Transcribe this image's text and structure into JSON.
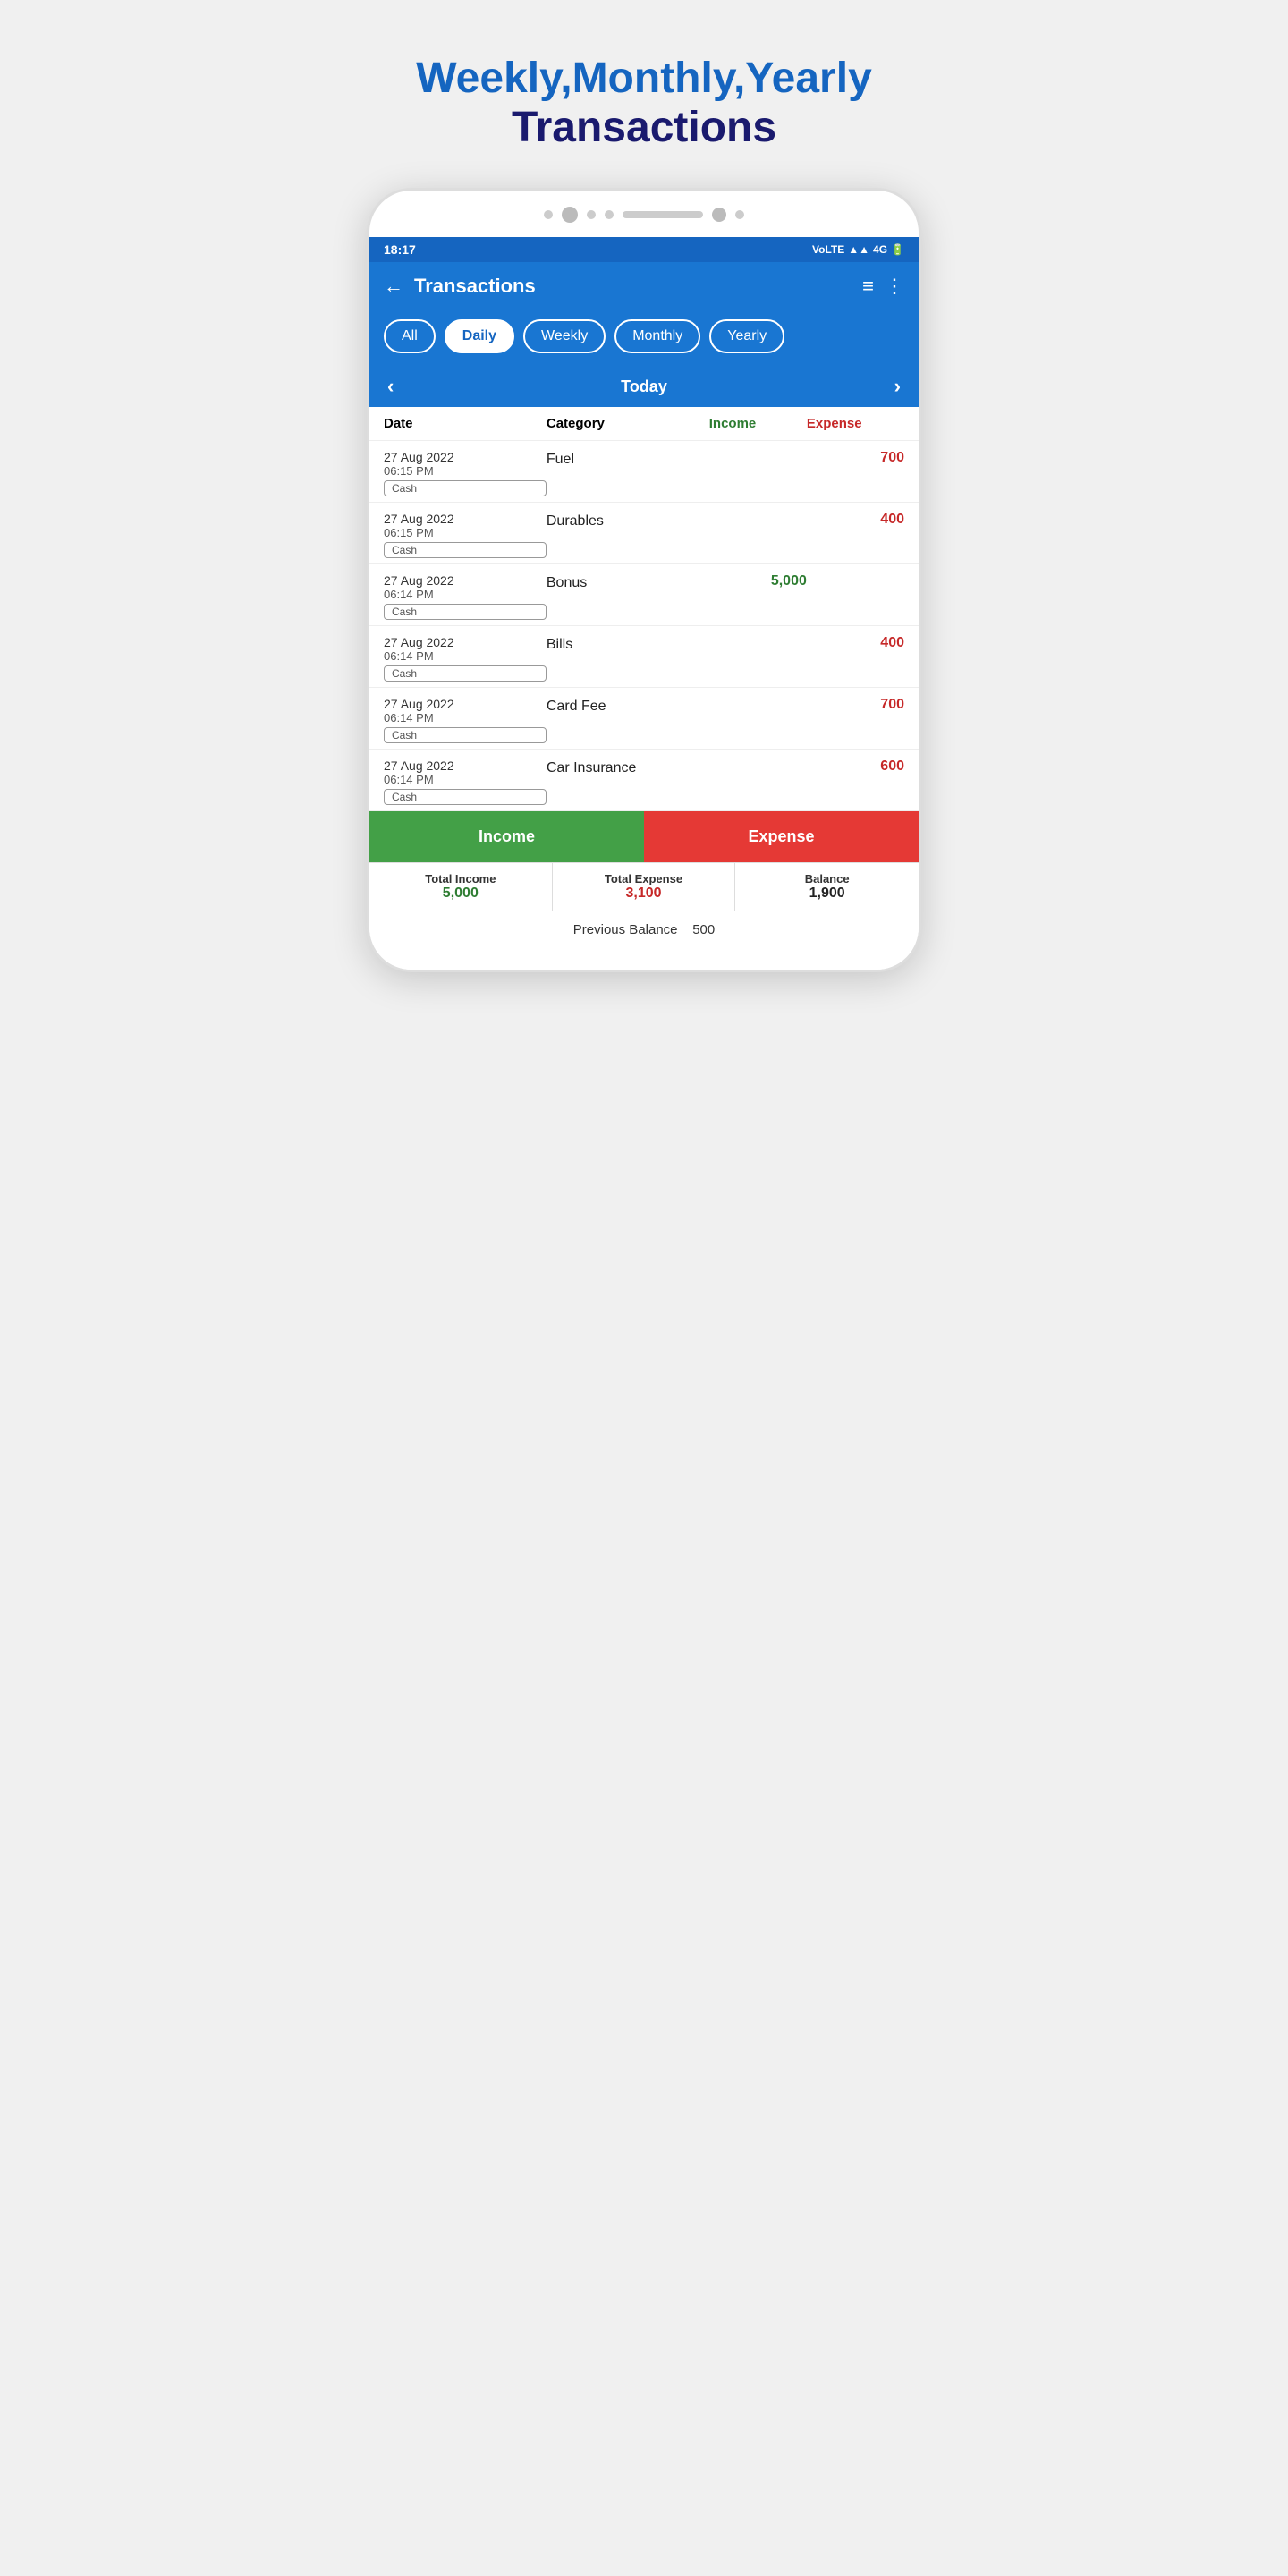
{
  "header": {
    "line1": "Weekly,Monthly,Yearly",
    "line2": "Transactions"
  },
  "statusBar": {
    "time": "18:17",
    "icons": "VolTE 4G"
  },
  "appBar": {
    "title": "Transactions",
    "backIcon": "←",
    "menuIcon": "≡",
    "moreIcon": "⋮"
  },
  "filters": [
    {
      "label": "All",
      "active": false
    },
    {
      "label": "Daily",
      "active": true
    },
    {
      "label": "Weekly",
      "active": false
    },
    {
      "label": "Monthly",
      "active": false
    },
    {
      "label": "Yearly",
      "active": false
    }
  ],
  "dateNav": {
    "prev": "‹",
    "current": "Today",
    "next": "›"
  },
  "tableHeaders": {
    "date": "Date",
    "category": "Category",
    "income": "Income",
    "expense": "Expense"
  },
  "transactions": [
    {
      "date": "27 Aug 2022",
      "time": "06:15 PM",
      "payment": "Cash",
      "category": "Fuel",
      "income": "",
      "expense": "700"
    },
    {
      "date": "27 Aug 2022",
      "time": "06:15 PM",
      "payment": "Cash",
      "category": "Durables",
      "income": "",
      "expense": "400"
    },
    {
      "date": "27 Aug 2022",
      "time": "06:14 PM",
      "payment": "Cash",
      "category": "Bonus",
      "income": "5,000",
      "expense": ""
    },
    {
      "date": "27 Aug 2022",
      "time": "06:14 PM",
      "payment": "Cash",
      "category": "Bills",
      "income": "",
      "expense": "400"
    },
    {
      "date": "27 Aug 2022",
      "time": "06:14 PM",
      "payment": "Cash",
      "category": "Card Fee",
      "income": "",
      "expense": "700"
    },
    {
      "date": "27 Aug 2022",
      "time": "06:14 PM",
      "payment": "Cash",
      "category": "Car Insurance",
      "income": "",
      "expense": "600"
    }
  ],
  "bottomButtons": {
    "income": "Income",
    "expense": "Expense"
  },
  "summary": {
    "totalIncomeLabel": "Total Income",
    "totalIncomeValue": "5,000",
    "totalExpenseLabel": "Total Expense",
    "totalExpenseValue": "3,100",
    "balanceLabel": "Balance",
    "balanceValue": "1,900"
  },
  "prevBalance": {
    "label": "Previous Balance",
    "value": "500"
  }
}
